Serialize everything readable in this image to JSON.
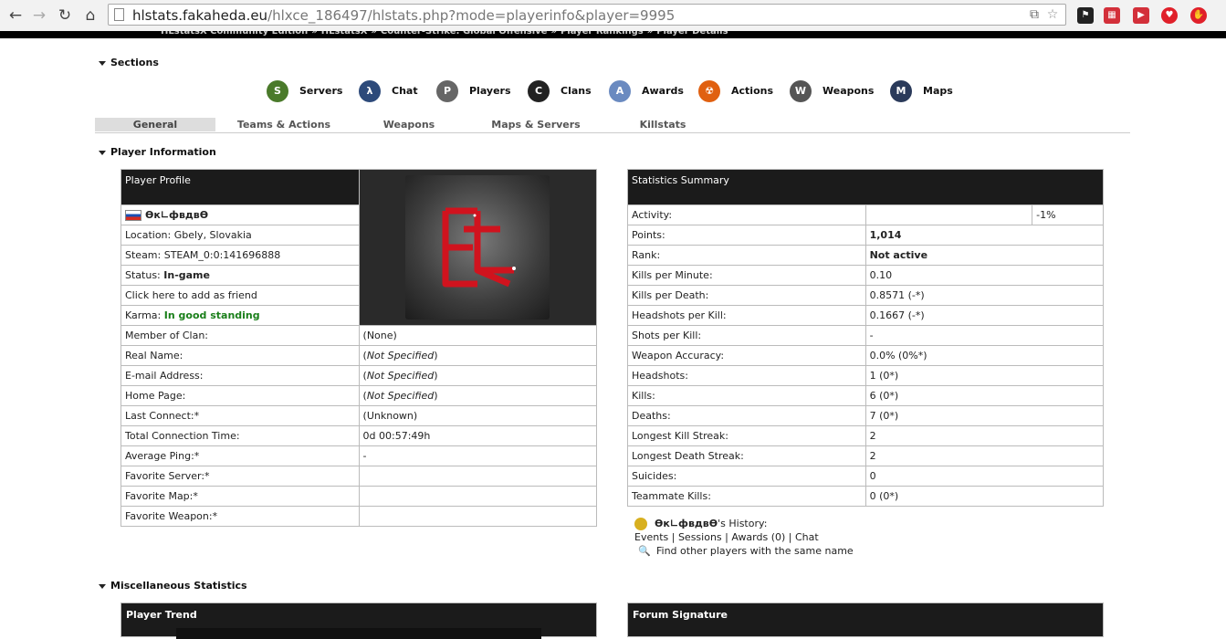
{
  "browser": {
    "url_host": "hlstats.fakaheda.eu",
    "url_path": "/hlxce_186497/hlstats.php?mode=playerinfo&player=9995"
  },
  "breadcrumb": [
    "HLstatsX Community Edition",
    "HLstatsX",
    "Counter-Strike: Global Offensive",
    "Player Rankings",
    "Player Details"
  ],
  "sections": {
    "sections_title": "Sections",
    "player_info_title": "Player Information",
    "misc_title": "Miscellaneous Statistics"
  },
  "nav": [
    {
      "label": "Servers",
      "icon": "servers-icon",
      "glyph": "S",
      "color": "#4a7a2a"
    },
    {
      "label": "Chat",
      "icon": "chat-icon",
      "glyph": "λ",
      "color": "#2d4a7a"
    },
    {
      "label": "Players",
      "icon": "players-icon",
      "glyph": "P",
      "color": "#666666"
    },
    {
      "label": "Clans",
      "icon": "clans-icon",
      "glyph": "C",
      "color": "#222222"
    },
    {
      "label": "Awards",
      "icon": "awards-icon",
      "glyph": "A",
      "color": "#6a8ac0"
    },
    {
      "label": "Actions",
      "icon": "actions-icon",
      "glyph": "☢",
      "color": "#e06010"
    },
    {
      "label": "Weapons",
      "icon": "weapons-icon",
      "glyph": "W",
      "color": "#555555"
    },
    {
      "label": "Maps",
      "icon": "maps-icon",
      "glyph": "M",
      "color": "#2a3a5a"
    }
  ],
  "tabs": [
    "General",
    "Teams & Actions",
    "Weapons",
    "Maps & Servers",
    "Killstats"
  ],
  "profile": {
    "header": "Player Profile",
    "name": "Ѳк∟фвдвѲ",
    "location": "Location: Gbely, Slovakia",
    "steam": "Steam: STEAM_0:0:141696888",
    "status_label": "Status:",
    "status_value": "In-game",
    "friend_link": "Click here to add as friend",
    "karma_label": "Karma:",
    "karma_value": "In good standing",
    "rows": [
      {
        "label": "Member of Clan:",
        "value": "(None)",
        "italic": false
      },
      {
        "label": "Real Name:",
        "value": "Not Specified",
        "italic": true
      },
      {
        "label": "E-mail Address:",
        "value": "Not Specified",
        "italic": true
      },
      {
        "label": "Home Page:",
        "value": "Not Specified",
        "italic": true
      },
      {
        "label": "Last Connect:*",
        "value": "(Unknown)",
        "italic": false
      },
      {
        "label": "Total Connection Time:",
        "value": "0d 00:57:49h",
        "italic": false
      },
      {
        "label": "Average Ping:*",
        "value": "-",
        "italic": false
      },
      {
        "label": "Favorite Server:*",
        "value": "",
        "italic": false
      },
      {
        "label": "Favorite Map:*",
        "value": "",
        "italic": false
      },
      {
        "label": "Favorite Weapon:*",
        "value": "",
        "italic": false
      }
    ]
  },
  "summary": {
    "header": "Statistics Summary",
    "activity_label": "Activity:",
    "activity_value": "-1%",
    "rows": [
      {
        "label": "Points:",
        "value": "1,014",
        "bold": true
      },
      {
        "label": "Rank:",
        "value": "Not active",
        "bold": true
      },
      {
        "label": "Kills per Minute:",
        "value": "0.10",
        "bold": false
      },
      {
        "label": "Kills per Death:",
        "value": "0.8571 (-*)",
        "bold": false
      },
      {
        "label": "Headshots per Kill:",
        "value": "0.1667 (-*)",
        "bold": false
      },
      {
        "label": "Shots per Kill:",
        "value": "-",
        "bold": false
      },
      {
        "label": "Weapon Accuracy:",
        "value": "0.0% (0%*)",
        "bold": false
      },
      {
        "label": "Headshots:",
        "value": "1 (0*)",
        "bold": false
      },
      {
        "label": "Kills:",
        "value": "6 (0*)",
        "bold": false
      },
      {
        "label": "Deaths:",
        "value": "7 (0*)",
        "bold": false
      },
      {
        "label": "Longest Kill Streak:",
        "value": "2",
        "bold": false
      },
      {
        "label": "Longest Death Streak:",
        "value": "2",
        "bold": false
      },
      {
        "label": "Suicides:",
        "value": "0",
        "bold": false
      },
      {
        "label": "Teammate Kills:",
        "value": "0 (0*)",
        "bold": false
      }
    ]
  },
  "history": {
    "name": "Ѳк∟фвдвѲ",
    "suffix": "'s History:",
    "links": [
      "Events",
      "Sessions",
      "Awards (0)",
      "Chat"
    ],
    "find_other": "Find other players with the same name"
  },
  "panels": {
    "trend": "Player Trend",
    "signature": "Forum Signature"
  }
}
